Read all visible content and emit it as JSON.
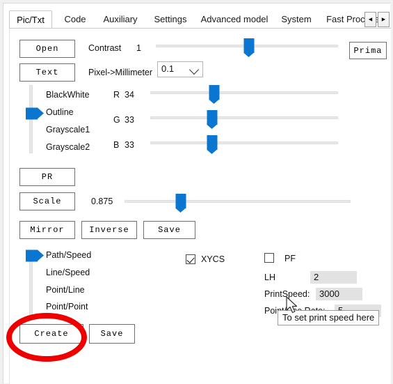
{
  "window": {
    "tabs": [
      {
        "label": "Pic/Txt",
        "selected": true
      },
      {
        "label": "Code",
        "selected": false
      },
      {
        "label": "Auxiliary",
        "selected": false
      },
      {
        "label": "Settings",
        "selected": false
      },
      {
        "label": "Advanced model",
        "selected": false
      },
      {
        "label": "System",
        "selected": false
      },
      {
        "label": "Fast Process",
        "selected": false
      }
    ],
    "tab_scroll_left": "◄",
    "tab_scroll_right": "►"
  },
  "toolbar": {
    "open_label": "Open",
    "text_label": "Text",
    "prima_label": "Prima"
  },
  "contrast": {
    "label": "Contrast",
    "value": "1",
    "slider_percent": 51
  },
  "pixel_mm": {
    "label": "Pixel->Millimeter",
    "value": "0.1"
  },
  "modes": {
    "items": [
      {
        "label": "BlackWhite",
        "selected": false
      },
      {
        "label": "Outline",
        "selected": true
      },
      {
        "label": "Grayscale1",
        "selected": false
      },
      {
        "label": "Grayscale2",
        "selected": false
      }
    ]
  },
  "channels": [
    {
      "name": "R",
      "value": "34",
      "slider_percent": 34
    },
    {
      "name": "G",
      "value": "33",
      "slider_percent": 33
    },
    {
      "name": "B",
      "value": "33",
      "slider_percent": 33
    }
  ],
  "actions": {
    "pr_label": "PR",
    "scale_label": "Scale",
    "scale_value": "0.875",
    "scale_slider_percent": 25,
    "mirror_label": "Mirror",
    "inverse_label": "Inverse",
    "save_label": "Save"
  },
  "path_modes": {
    "items": [
      {
        "label": "Path/Speed",
        "selected": true
      },
      {
        "label": "Line/Speed",
        "selected": false
      },
      {
        "label": "Point/Line",
        "selected": false
      },
      {
        "label": "Point/Point",
        "selected": false
      }
    ]
  },
  "options": {
    "xycs": {
      "label": "XYCS",
      "checked": true
    },
    "pf": {
      "label": "PF",
      "checked": false
    }
  },
  "params": [
    {
      "label": "LH",
      "value": "2"
    },
    {
      "label": "PrintSpeed:",
      "value": "3000"
    },
    {
      "label": "Point/Use Rate:",
      "value": "5"
    }
  ],
  "bottom": {
    "create_label": "Create",
    "save_label": "Save"
  },
  "tooltip": {
    "text": "To set print speed here"
  },
  "colors": {
    "accent": "#0b76d0",
    "annotation": "#ee0000",
    "field_bg": "#e2e2e2"
  }
}
